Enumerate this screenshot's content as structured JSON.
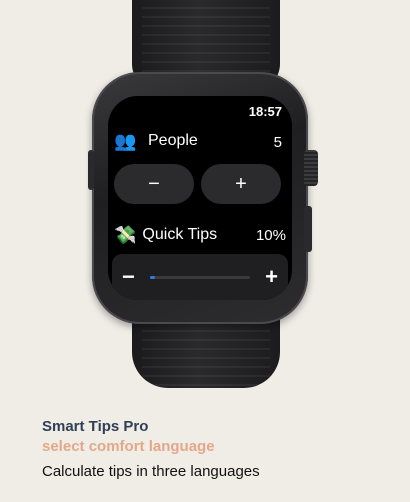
{
  "watch": {
    "time": "18:57",
    "people": {
      "icon": "people-icon",
      "label": "People",
      "value": "5"
    },
    "stepper": {
      "minus_label": "−",
      "plus_label": "+"
    },
    "tips": {
      "icon": "money-hand-icon",
      "label": "Quick Tips",
      "value": "10%"
    },
    "slider": {
      "minus_label": "−",
      "plus_label": "+",
      "level": 0.05
    }
  },
  "caption": {
    "title": "Smart Tips Pro",
    "subtitle": "select comfort language",
    "description": "Calculate tips in three languages"
  },
  "colors": {
    "background": "#f0ece6",
    "title": "#2f3f55",
    "subtitle": "#e3a88a",
    "slider_fill": "#2f7bd9"
  }
}
